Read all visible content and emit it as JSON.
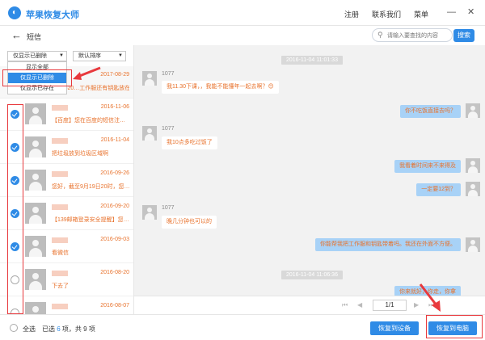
{
  "app": {
    "title": "苹果恢复大师",
    "logo_glyph": "◐",
    "top_links": [
      "注册",
      "联系我们",
      "菜单"
    ],
    "win_controls": {
      "minimize": "—",
      "close": "✕"
    }
  },
  "subheader": {
    "back_glyph": "←",
    "title": "短信",
    "search_placeholder": "请输入要查找的内容",
    "search_button": "搜索"
  },
  "filters": {
    "show_select": "仅显示已删除",
    "sort_select": "默认排序",
    "dropdown_options": [
      "显示全部",
      "仅显示已删除",
      "仅显示已存在"
    ],
    "selected_option_index": 1
  },
  "conversations": [
    {
      "date": "2017-08-29",
      "preview": "1960620…工作服还有钥匙放在了…",
      "checked": null
    },
    {
      "date": "2016-11-06",
      "preview": "【百度】您在百度的短信注…",
      "checked": true
    },
    {
      "date": "2016-11-04",
      "preview": "把垃圾放到垃圾区域啊",
      "checked": true
    },
    {
      "date": "2016-09-26",
      "preview": "您好，截至9月19日20时，您…",
      "checked": true
    },
    {
      "date": "2016-09-20",
      "preview": "【139邮箱登录安全提醒】您…",
      "checked": true
    },
    {
      "date": "2016-09-03",
      "preview": "看微信",
      "checked": true
    },
    {
      "date": "2016-08-20",
      "preview": "下去了",
      "checked": false
    },
    {
      "date": "2016-08-07",
      "preview": "",
      "checked": false
    }
  ],
  "chat": {
    "timestamps": [
      "2016-11-04 11:01:33",
      "2016-11-04 11:06:36"
    ],
    "incoming": [
      {
        "sender": "1077",
        "text": "我11.30下课，，我能不能懂年一起去啊？😊"
      },
      {
        "sender": "1077",
        "text": "我10点多吃过饭了"
      },
      {
        "sender": "1077",
        "text": "晚几分钟也可以的"
      }
    ],
    "outgoing": [
      "你不吃饭直接去吗？",
      "我看着时间来不来得及",
      "一定要12到？",
      "你能帮我把工作服和钥匙带着吗。我还在外面不方便。",
      "你来就好，你走，你拿"
    ]
  },
  "pager": {
    "first": "⏮",
    "prev": "◀",
    "page": "1/1",
    "next": "▶",
    "last": "⏭"
  },
  "footer": {
    "select_all": "全选",
    "status_prefix": "已选",
    "selected_count": "6",
    "status_middle": "项，共",
    "total_count": "9",
    "status_suffix": "项",
    "btn_device": "恢复到设备",
    "btn_pc": "恢复到电脑"
  },
  "colors": {
    "accent": "#2f8be6",
    "highlight": "#e8393d",
    "preview_text": "#e8722c"
  }
}
